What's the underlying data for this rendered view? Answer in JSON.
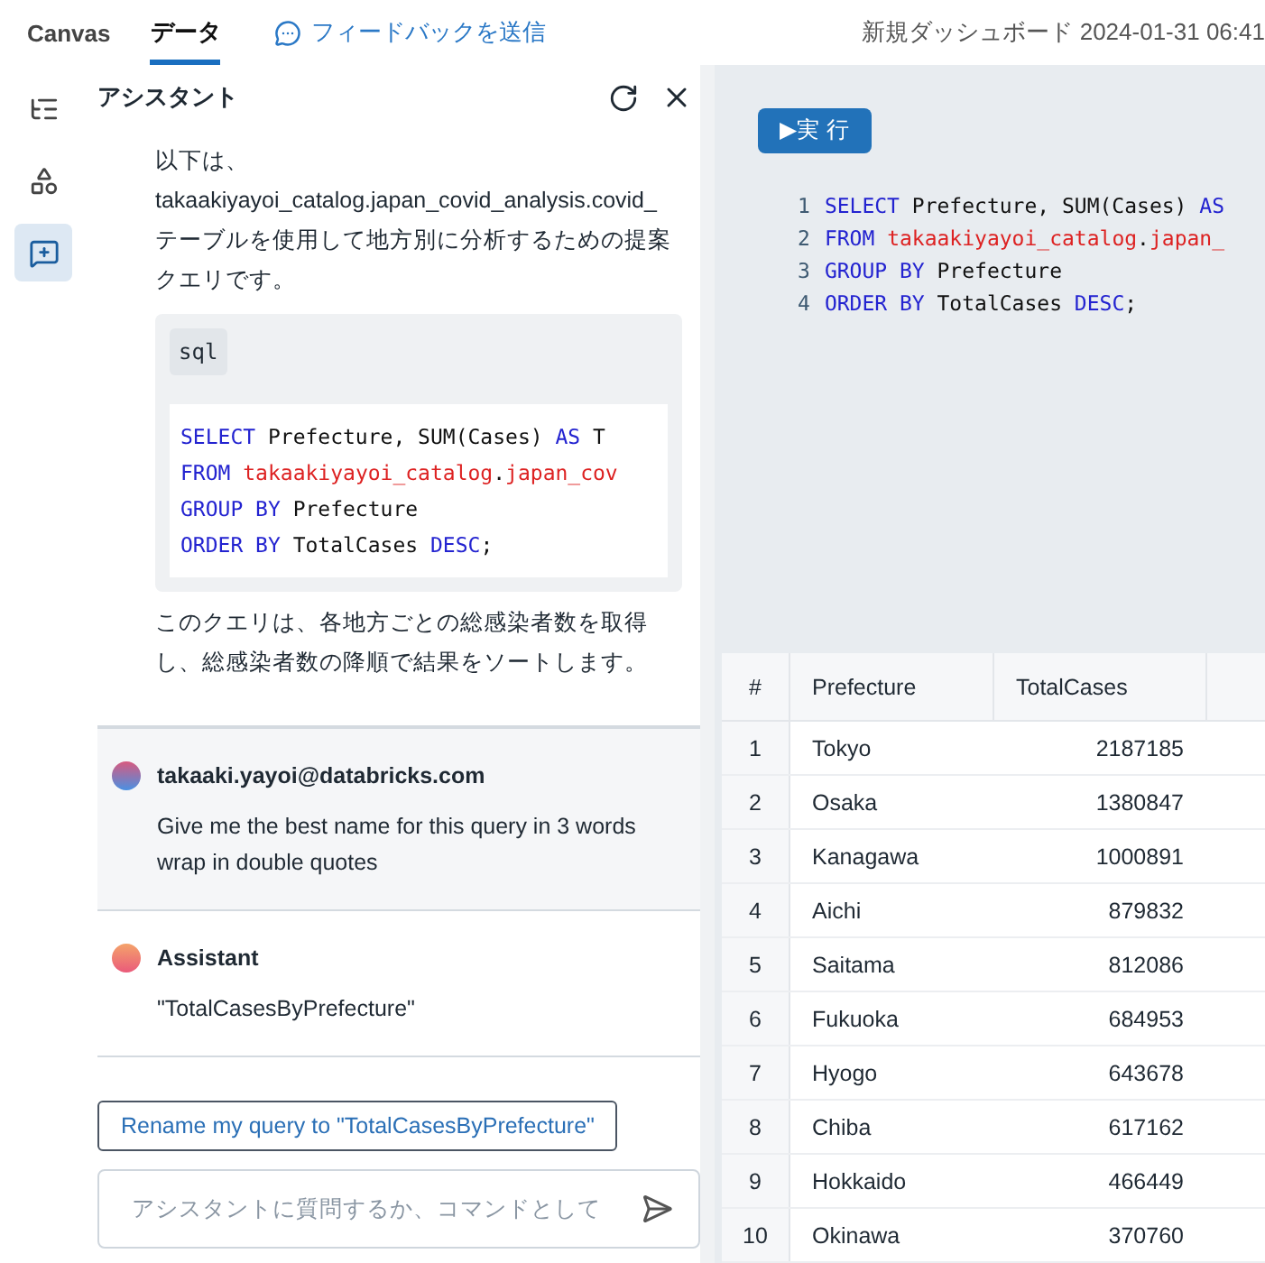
{
  "top_bar": {
    "tabs": [
      {
        "label": "Canvas",
        "selected": false
      },
      {
        "label": "データ",
        "selected": true
      }
    ],
    "feedback_link": "フィードバックを送信",
    "dashboard_title": "新規ダッシュボード 2024-01-31 06:41"
  },
  "rail": [
    {
      "selected": false
    },
    {
      "selected": false
    },
    {
      "selected": true
    }
  ],
  "assistant": {
    "title": "アシスタント",
    "intro": [
      "以下は、",
      "takaakiyayoi_catalog.japan_covid_analysis.covid_",
      "テーブルを使用して地方別に分析するための提案クエリです。"
    ],
    "code_language": "sql",
    "code_lines": [
      [
        {
          "kind": "keyword",
          "text": "SELECT"
        },
        {
          "kind": "text",
          "text": " Prefecture, SUM(Cases) "
        },
        {
          "kind": "keyword",
          "text": "AS"
        },
        {
          "kind": "text",
          "text": " T"
        }
      ],
      [
        {
          "kind": "keyword",
          "text": "FROM"
        },
        {
          "kind": "table",
          "text": " takaakiyayoi_catalog"
        },
        {
          "kind": "text",
          "text": "."
        },
        {
          "kind": "table",
          "text": "japan_cov"
        }
      ],
      [
        {
          "kind": "keyword",
          "text": "GROUP BY"
        },
        {
          "kind": "text",
          "text": " Prefecture"
        }
      ],
      [
        {
          "kind": "keyword",
          "text": "ORDER BY"
        },
        {
          "kind": "text",
          "text": " TotalCases "
        },
        {
          "kind": "keyword",
          "text": "DESC"
        },
        {
          "kind": "text",
          "text": ";"
        }
      ]
    ],
    "outro": "このクエリは、各地方ごとの総感染者数を取得し、総感染者数の降順で結果をソートします。",
    "messages": [
      {
        "kind": "user",
        "author": "takaaki.yayoi@databricks.com",
        "text": "Give me the best name for this query in 3 words wrap in double quotes"
      },
      {
        "kind": "assistant",
        "author": "Assistant",
        "text": "\"TotalCasesByPrefecture\""
      }
    ],
    "suggestion": "Rename my query to \"TotalCasesByPrefecture\"",
    "input": {
      "placeholder": "アシスタントに質問するか、コマンドとして"
    }
  },
  "editor": {
    "run_button": "▶実 行",
    "lines": [
      {
        "number": "1",
        "tokens": [
          {
            "kind": "keyword",
            "text": "SELECT"
          },
          {
            "kind": "text",
            "text": " Prefecture, SUM(Cases) "
          },
          {
            "kind": "keyword",
            "text": "AS"
          }
        ]
      },
      {
        "number": "2",
        "tokens": [
          {
            "kind": "keyword",
            "text": "FROM"
          },
          {
            "kind": "table",
            "text": " takaakiyayoi_catalog"
          },
          {
            "kind": "text",
            "text": "."
          },
          {
            "kind": "table",
            "text": "japan_"
          }
        ]
      },
      {
        "number": "3",
        "tokens": [
          {
            "kind": "keyword",
            "text": "GROUP BY"
          },
          {
            "kind": "text",
            "text": " Prefecture"
          }
        ]
      },
      {
        "number": "4",
        "tokens": [
          {
            "kind": "keyword",
            "text": "ORDER BY"
          },
          {
            "kind": "text",
            "text": " TotalCases "
          },
          {
            "kind": "keyword",
            "text": "DESC"
          },
          {
            "kind": "text",
            "text": ";"
          }
        ]
      }
    ]
  },
  "table": {
    "columns": [
      "#",
      "Prefecture",
      "TotalCases"
    ],
    "rows": [
      [
        "1",
        "Tokyo",
        "2187185"
      ],
      [
        "2",
        "Osaka",
        "1380847"
      ],
      [
        "3",
        "Kanagawa",
        "1000891"
      ],
      [
        "4",
        "Aichi",
        "879832"
      ],
      [
        "5",
        "Saitama",
        "812086"
      ],
      [
        "6",
        "Fukuoka",
        "684953"
      ],
      [
        "7",
        "Hyogo",
        "643678"
      ],
      [
        "8",
        "Chiba",
        "617162"
      ],
      [
        "9",
        "Hokkaido",
        "466449"
      ],
      [
        "10",
        "Okinawa",
        "370760"
      ]
    ]
  }
}
